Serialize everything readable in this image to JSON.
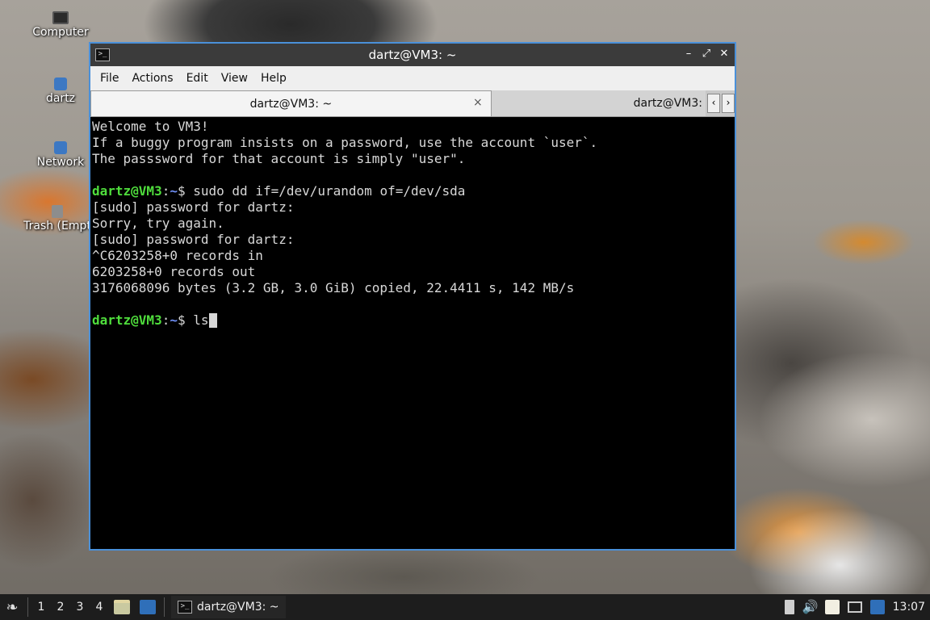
{
  "desktop": {
    "icons": [
      {
        "label": "Computer",
        "icon": "computer-icon"
      },
      {
        "label": "dartz",
        "icon": "home-folder-icon"
      },
      {
        "label": "Network",
        "icon": "network-icon"
      },
      {
        "label": "Trash (Empt",
        "icon": "trash-icon"
      }
    ]
  },
  "window": {
    "title": "dartz@VM3: ~",
    "app_icon": "terminal-icon",
    "controls": {
      "minimize": "–",
      "maximize": "⤢",
      "close": "✕"
    },
    "menu": [
      "File",
      "Actions",
      "Edit",
      "View",
      "Help"
    ],
    "tabs": [
      {
        "label": "dartz@VM3: ~",
        "active": true,
        "close": "×"
      },
      {
        "label": "dartz@VM3:",
        "active": false
      }
    ],
    "tab_scroll": {
      "left": "‹",
      "right": "›"
    }
  },
  "terminal": {
    "lines": [
      {
        "type": "text",
        "text": "Welcome to VM3!"
      },
      {
        "type": "text",
        "text": "If a buggy program insists on a password, use the account `user`."
      },
      {
        "type": "text",
        "text": "The passsword for that account is simply \"user\"."
      },
      {
        "type": "text",
        "text": ""
      },
      {
        "type": "prompt",
        "user": "dartz@VM3",
        "sep": ":",
        "path": "~",
        "sym": "$ ",
        "cmd": "sudo dd if=/dev/urandom of=/dev/sda"
      },
      {
        "type": "text",
        "text": "[sudo] password for dartz:"
      },
      {
        "type": "text",
        "text": "Sorry, try again."
      },
      {
        "type": "text",
        "text": "[sudo] password for dartz:"
      },
      {
        "type": "text",
        "text": "^C6203258+0 records in"
      },
      {
        "type": "text",
        "text": "6203258+0 records out"
      },
      {
        "type": "text",
        "text": "3176068096 bytes (3.2 GB, 3.0 GiB) copied, 22.4411 s, 142 MB/s"
      },
      {
        "type": "text",
        "text": ""
      },
      {
        "type": "prompt",
        "user": "dartz@VM3",
        "sep": ":",
        "path": "~",
        "sym": "$ ",
        "cmd": "ls",
        "cursor": true
      }
    ],
    "colors": {
      "user": "#4fdd3c",
      "path": "#6f8ff5",
      "text": "#d8d8d8",
      "bg": "#000000"
    }
  },
  "taskbar": {
    "start_icon": "start-menu-icon",
    "workspaces": [
      "1",
      "2",
      "3",
      "4"
    ],
    "quicklaunch": [
      "file-manager-icon",
      "show-desktop-icon"
    ],
    "task": {
      "label": "dartz@VM3: ~",
      "icon": "terminal-icon"
    },
    "tray": [
      "battery-icon",
      "volume-icon",
      "clipboard-icon",
      "screen-icon",
      "network-icon"
    ],
    "clock": "13:07"
  }
}
